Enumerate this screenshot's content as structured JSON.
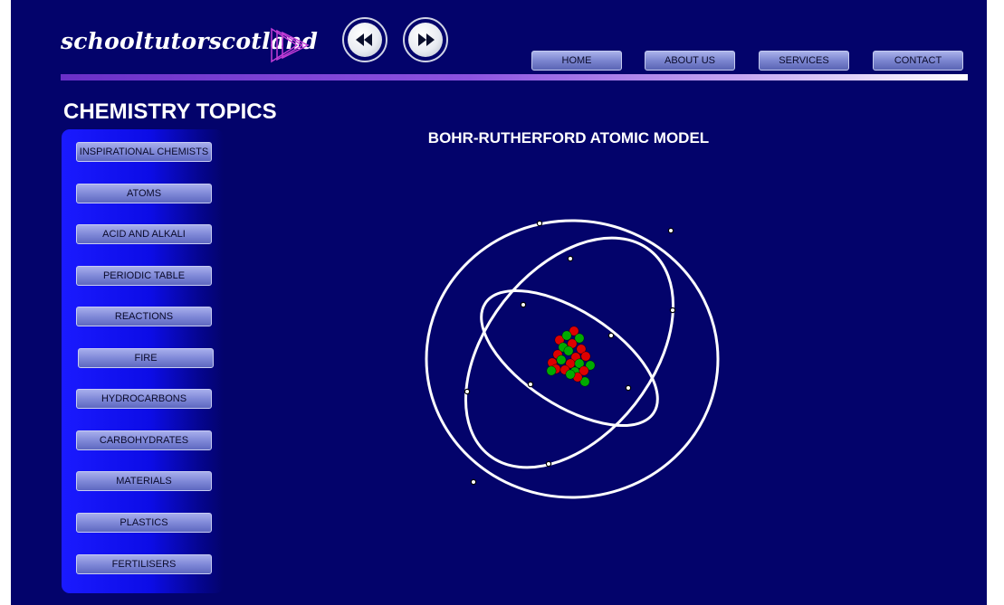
{
  "header": {
    "logo_text": "schooltutorscotland",
    "nav": [
      {
        "label": "HOME"
      },
      {
        "label": "ABOUT US"
      },
      {
        "label": "SERVICES"
      },
      {
        "label": "CONTACT"
      }
    ],
    "media_buttons": [
      {
        "icon": "rewind-icon"
      },
      {
        "icon": "fast-forward-icon"
      }
    ]
  },
  "sidebar": {
    "title": "CHEMISTRY TOPICS",
    "items": [
      {
        "label": "INSPIRATIONAL CHEMISTS"
      },
      {
        "label": "ATOMS"
      },
      {
        "label": "ACID AND ALKALI"
      },
      {
        "label": "PERIODIC TABLE"
      },
      {
        "label": "REACTIONS"
      },
      {
        "label": "FIRE"
      },
      {
        "label": "HYDROCARBONS"
      },
      {
        "label": "CARBOHYDRATES"
      },
      {
        "label": "MATERIALS"
      },
      {
        "label": "PLASTICS"
      },
      {
        "label": "FERTILISERS"
      }
    ]
  },
  "main": {
    "title": "BOHR-RUTHERFORD ATOMIC MODEL"
  },
  "colors": {
    "background": "#03036b",
    "sidebar": "#1a1aff",
    "button": "#8089d8",
    "proton": "#dd0000",
    "neutron": "#00aa00",
    "orbit": "#ffffff"
  }
}
